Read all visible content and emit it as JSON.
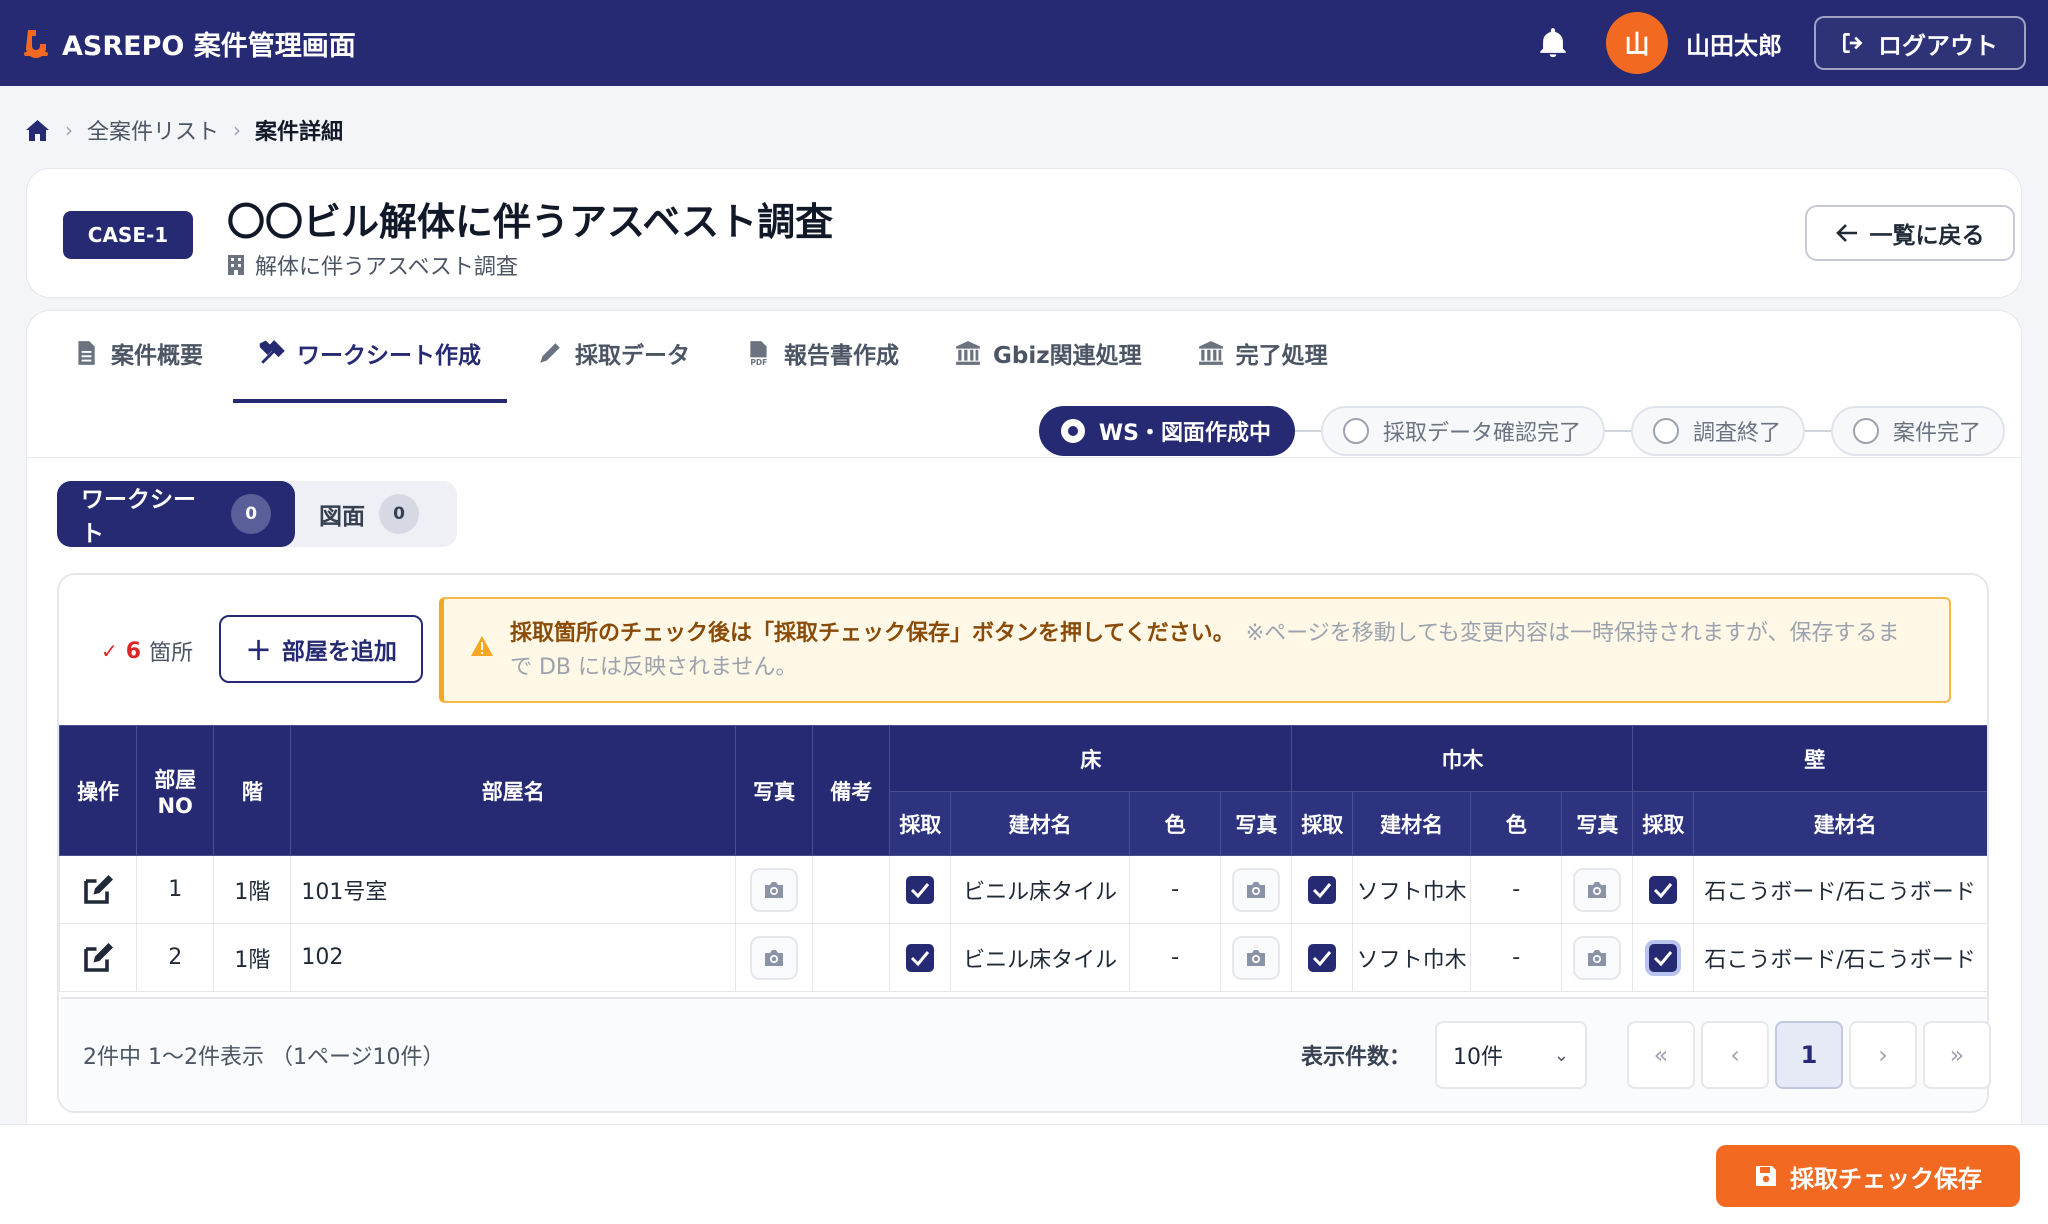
{
  "app": {
    "title": "ASREPO 案件管理画面"
  },
  "user": {
    "avatar_initial": "山",
    "name": "山田太郎",
    "logout_label": "ログアウト"
  },
  "breadcrumb": {
    "items": [
      "全案件リスト",
      "案件詳細"
    ]
  },
  "case": {
    "badge": "CASE-1",
    "title": "〇〇ビル解体に伴うアスベスト調査",
    "subtitle": "解体に伴うアスベスト調査",
    "back_label": "一覧に戻る"
  },
  "tabs": [
    {
      "label": "案件概要",
      "icon": "document-icon"
    },
    {
      "label": "ワークシート作成",
      "icon": "tools-icon",
      "active": true
    },
    {
      "label": "採取データ",
      "icon": "pencil-icon"
    },
    {
      "label": "報告書作成",
      "icon": "pdf-icon"
    },
    {
      "label": "Gbiz関連処理",
      "icon": "bank-icon"
    },
    {
      "label": "完了処理",
      "icon": "bank-icon"
    }
  ],
  "steps": [
    {
      "label": "WS・図面作成中",
      "active": true
    },
    {
      "label": "採取データ確認完了"
    },
    {
      "label": "調査終了"
    },
    {
      "label": "案件完了"
    }
  ],
  "segment": [
    {
      "label": "ワークシート",
      "count": "0",
      "active": true
    },
    {
      "label": "図面",
      "count": "0"
    }
  ],
  "worksheet": {
    "count_number": "6",
    "count_unit": "箇所",
    "add_room_label": "部屋を追加",
    "alert_strong": "採取箇所のチェック後は「採取チェック保存」ボタンを押してください。",
    "alert_note": "※ページを移動しても変更内容は一時保持されますが、保存するまで DB には反映されません。"
  },
  "table": {
    "headers": {
      "op": "操作",
      "room_no": "部屋NO",
      "floor": "階",
      "room_name": "部屋名",
      "photo": "写真",
      "note": "備考"
    },
    "groups": [
      "床",
      "巾木",
      "壁"
    ],
    "sub_headers": {
      "sample": "採取",
      "material": "建材名",
      "color": "色",
      "photo": "写真"
    },
    "rows": [
      {
        "no": "1",
        "floor": "1階",
        "room": "101号室",
        "floor_material": "ビニル床タイル",
        "floor_color": "-",
        "baseboard_material": "ソフト巾木",
        "baseboard_color": "-",
        "wall_material": "石こうボード/石こうボード"
      },
      {
        "no": "2",
        "floor": "1階",
        "room": "102",
        "floor_material": "ビニル床タイル",
        "floor_color": "-",
        "baseboard_material": "ソフト巾木",
        "baseboard_color": "-",
        "wall_material": "石こうボード/石こうボード"
      }
    ]
  },
  "pagination": {
    "info": "2件中 1〜2件表示 （1ページ10件）",
    "per_page_label": "表示件数：",
    "per_page_value": "10件",
    "current_page": "1"
  },
  "actions": {
    "save_label": "採取チェック保存"
  },
  "colors": {
    "primary": "#262a72",
    "accent": "#f26a21",
    "warning_bg": "#fff8e6"
  }
}
